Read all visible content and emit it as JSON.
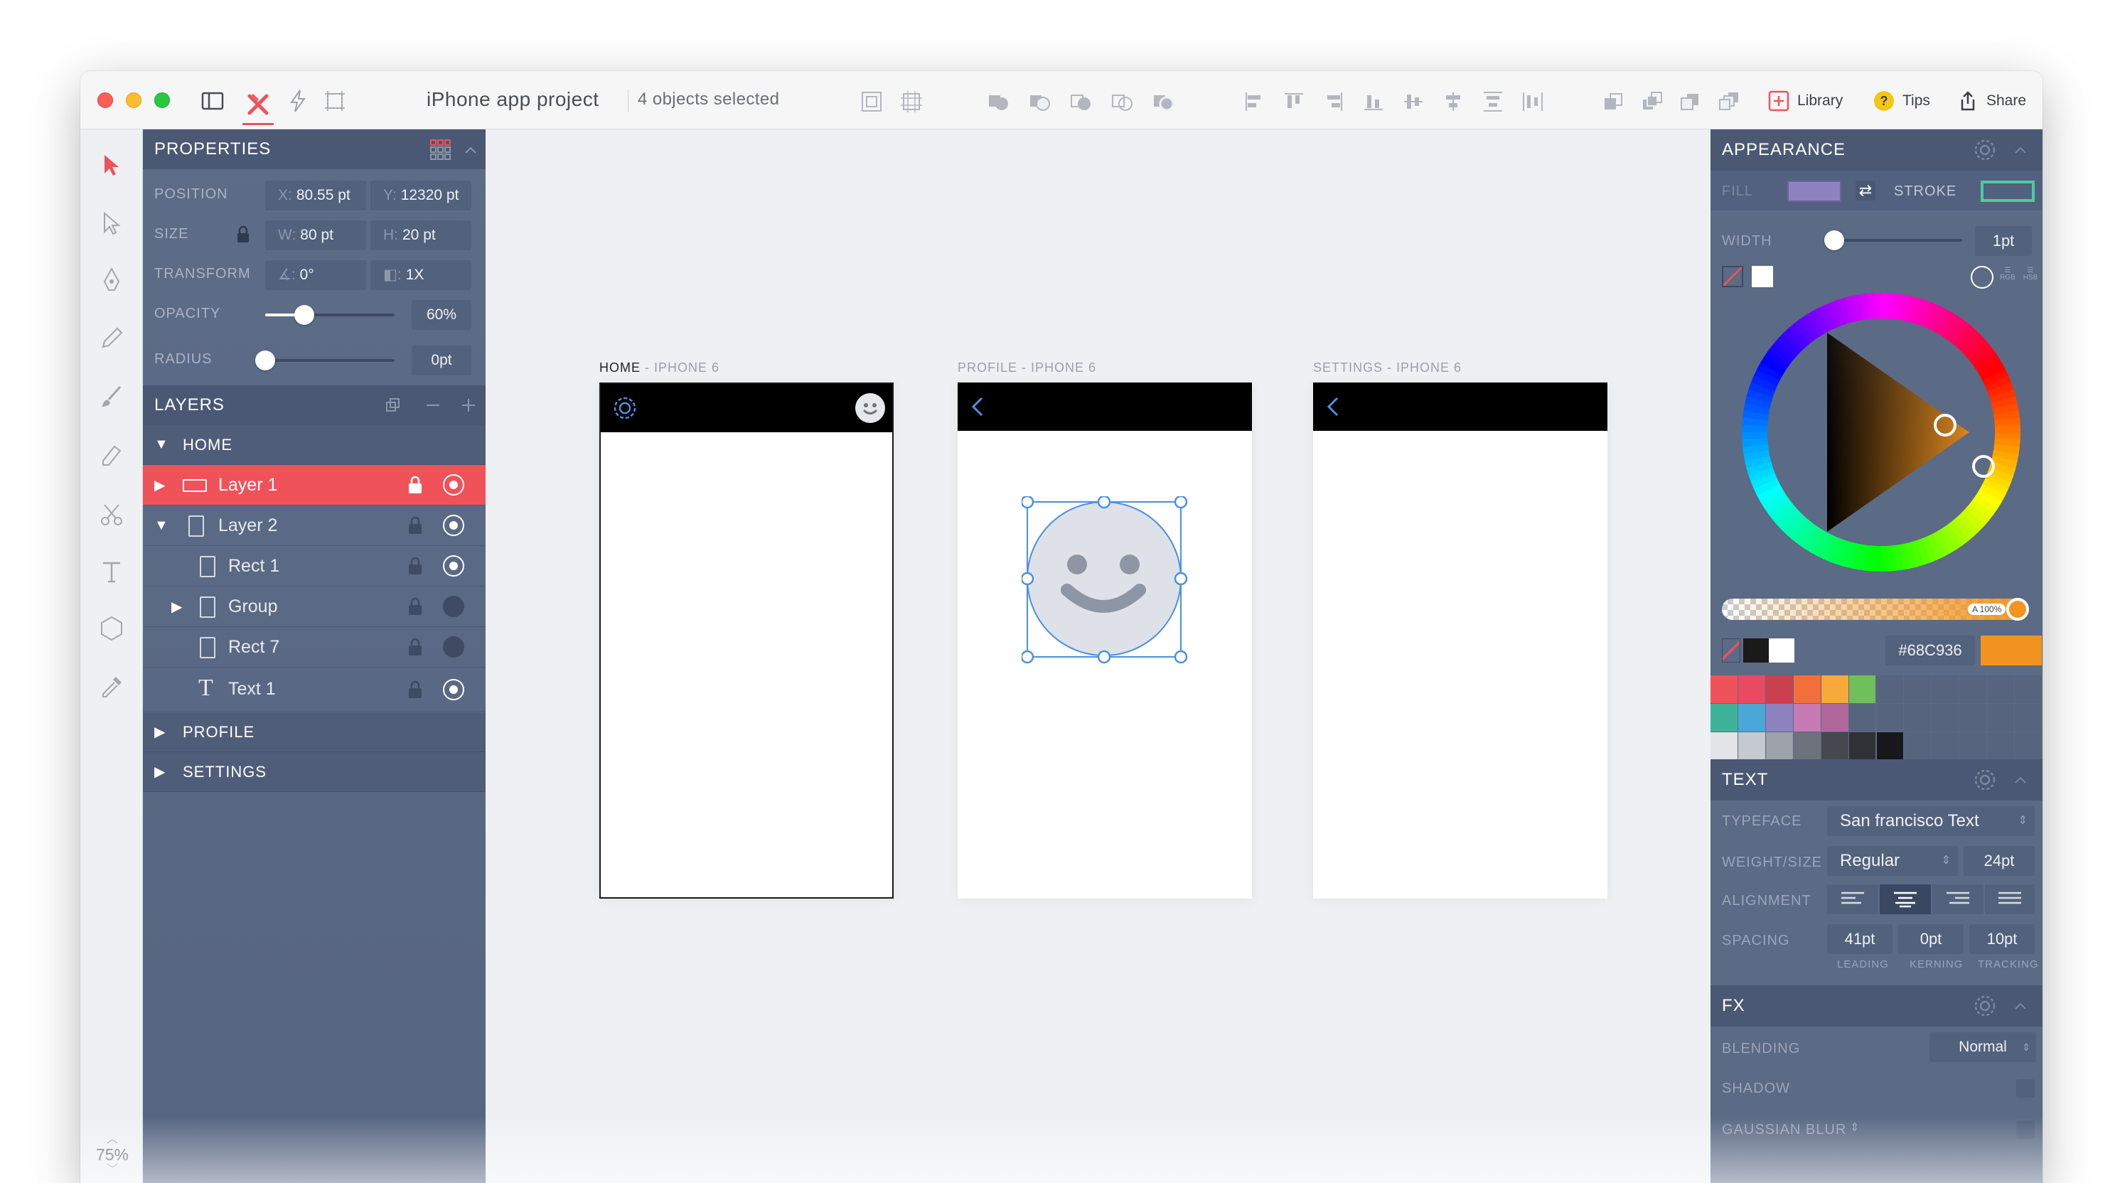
{
  "app": {
    "title": "iPhone app project",
    "selection_status": "4 objects selected",
    "zoom": "75%",
    "toolbar_right": [
      {
        "label": "Library",
        "icon": "library-plus-icon"
      },
      {
        "label": "Tips",
        "icon": "tips-question-icon"
      },
      {
        "label": "Share",
        "icon": "share-icon"
      }
    ]
  },
  "properties": {
    "header": "PROPERTIES",
    "position": {
      "label": "POSITION",
      "x_prefix": "X:",
      "x": "80.55 pt",
      "y_prefix": "Y:",
      "y": "12320 pt"
    },
    "size": {
      "label": "SIZE",
      "w_prefix": "W:",
      "w": "80 pt",
      "h_prefix": "H:",
      "h": "20 pt"
    },
    "transform": {
      "label": "TRANSFORM",
      "rotation": "0°",
      "scale": "1X"
    },
    "opacity": {
      "label": "OPACITY",
      "value": "60%",
      "level": 0.6
    },
    "radius": {
      "label": "RADIUS",
      "value": "0pt",
      "level": 0
    }
  },
  "layers": {
    "header": "LAYERS",
    "groups": [
      {
        "name": "HOME",
        "expanded": true
      },
      {
        "name": "PROFILE",
        "expanded": false
      },
      {
        "name": "SETTINGS",
        "expanded": false
      }
    ],
    "items": [
      {
        "name": "Layer 1",
        "active": true,
        "visible": true
      },
      {
        "name": "Layer 2",
        "active": false,
        "visible": true
      },
      {
        "name": "Rect 1",
        "active": false,
        "visible": true
      },
      {
        "name": "Group",
        "active": false,
        "visible": false
      },
      {
        "name": "Rect 7",
        "active": false,
        "visible": false
      },
      {
        "name": "Text 1",
        "active": false,
        "visible": true
      }
    ]
  },
  "artboards": [
    {
      "name": "HOME",
      "device": "IPHONE 6"
    },
    {
      "name": "PROFILE",
      "device": "IPHONE 6"
    },
    {
      "name": "SETTINGS",
      "device": "IPHONE 6"
    }
  ],
  "appearance": {
    "header": "APPEARANCE",
    "fill_label": "FILL",
    "stroke_label": "STROKE",
    "width_label": "WIDTH",
    "width_value": "1pt",
    "alpha_label": "A 100%",
    "hex": "#68C936",
    "colors": {
      "fill": "#8e82c0",
      "stroke": "#4ecb9e",
      "accent": "#f39320",
      "selection": "#4a90e2",
      "active_layer": "#f0525a"
    },
    "palette_row1": [
      "#f0525a",
      "#e84a5f",
      "#c9414f",
      "#f26f3b",
      "#f7a93b",
      "#6fbf5a"
    ],
    "palette_row2": [
      "#3fb39a",
      "#4aa8d8",
      "#8e82c0",
      "#c77ab3",
      "#b0689a"
    ],
    "palette_row3": [
      "#e2e4e8",
      "#c6c9cf",
      "#9da2ab",
      "#6d727c",
      "#45494f",
      "#2e3136",
      "#16181b"
    ]
  },
  "text": {
    "header": "TEXT",
    "typeface_label": "TYPEFACE",
    "typeface": "San francisco Text",
    "weight_label": "WEIGHT/SIZE",
    "weight": "Regular",
    "size": "24pt",
    "alignment_label": "ALIGNMENT",
    "spacing_label": "SPACING",
    "leading": "41pt",
    "kerning": "0pt",
    "tracking": "10pt",
    "leading_label": "LEADING",
    "kerning_label": "KERNING",
    "tracking_label": "TRACKING"
  },
  "fx": {
    "header": "FX",
    "blending_label": "BLENDING",
    "blending": "Normal",
    "shadow_label": "SHADOW",
    "blur_label": "GAUSSIAN BLUR"
  }
}
